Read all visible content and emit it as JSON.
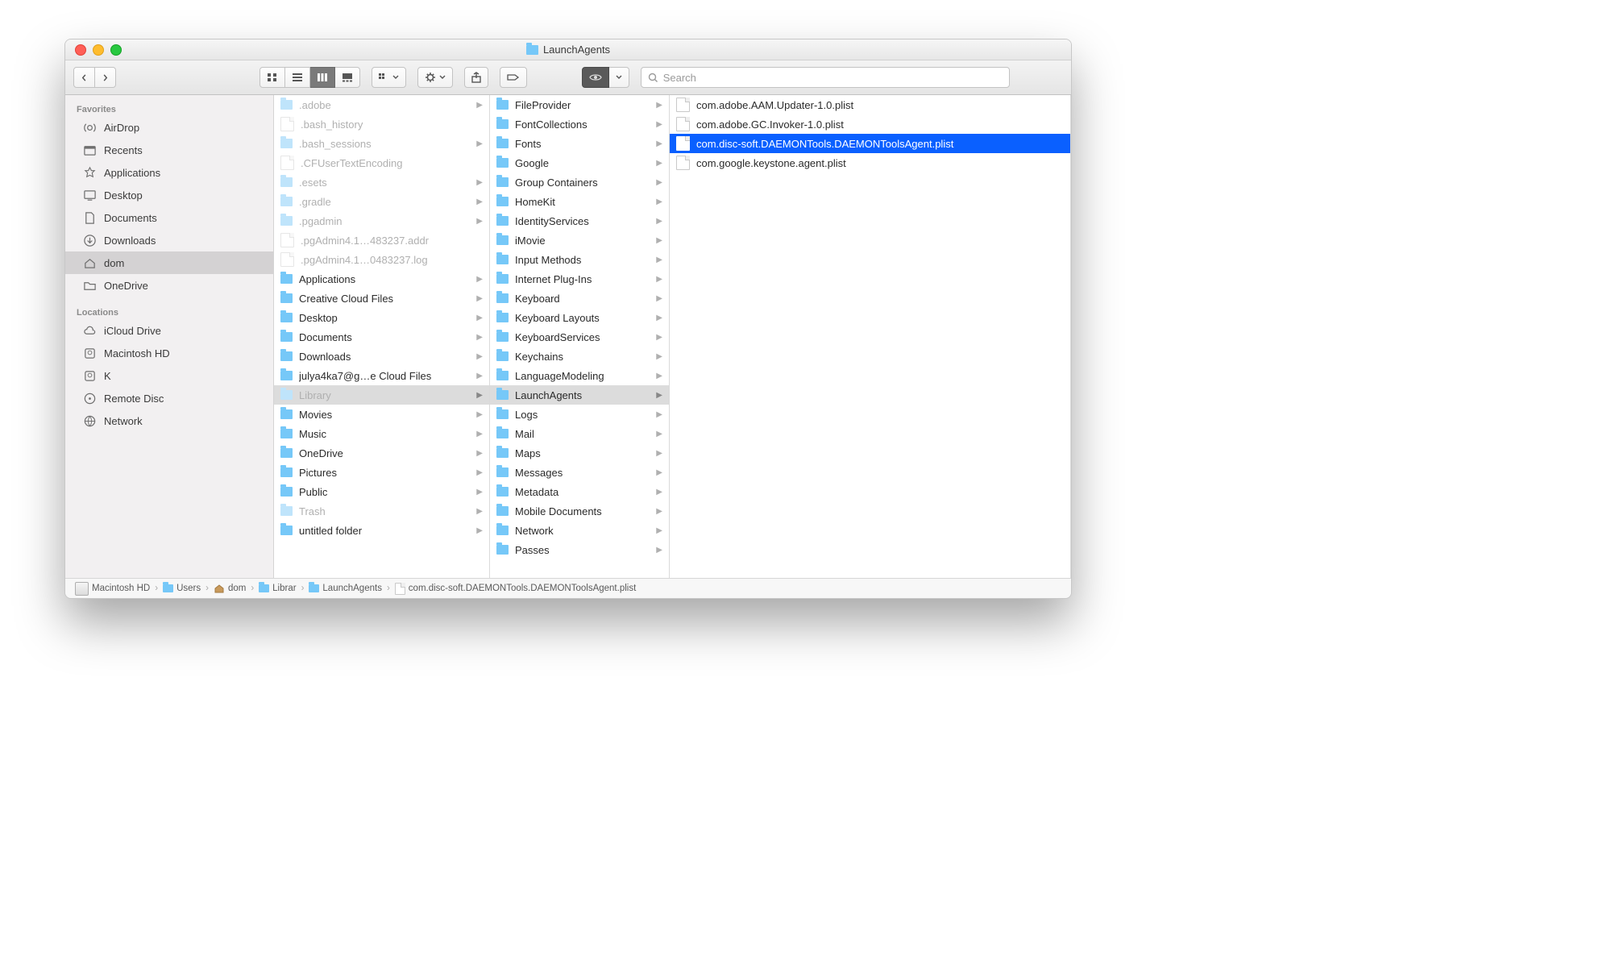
{
  "window_title": "LaunchAgents",
  "search_placeholder": "Search",
  "sidebar": {
    "favorites_label": "Favorites",
    "locations_label": "Locations",
    "favorites": [
      {
        "label": "AirDrop",
        "icon": "airdrop"
      },
      {
        "label": "Recents",
        "icon": "recents"
      },
      {
        "label": "Applications",
        "icon": "apps"
      },
      {
        "label": "Desktop",
        "icon": "desktop"
      },
      {
        "label": "Documents",
        "icon": "docs"
      },
      {
        "label": "Downloads",
        "icon": "downloads"
      },
      {
        "label": "dom",
        "icon": "home",
        "selected": true
      },
      {
        "label": "OneDrive",
        "icon": "folder"
      }
    ],
    "locations": [
      {
        "label": "iCloud Drive",
        "icon": "cloud"
      },
      {
        "label": "Macintosh HD",
        "icon": "hdd"
      },
      {
        "label": "K",
        "icon": "hdd"
      },
      {
        "label": "Remote Disc",
        "icon": "disc"
      },
      {
        "label": "Network",
        "icon": "network"
      }
    ]
  },
  "columns": {
    "col1": [
      {
        "label": ".adobe",
        "type": "folder-dim",
        "arrow": true
      },
      {
        "label": ".bash_history",
        "type": "file-dim"
      },
      {
        "label": ".bash_sessions",
        "type": "folder-dim",
        "arrow": true
      },
      {
        "label": ".CFUserTextEncoding",
        "type": "file-dim"
      },
      {
        "label": ".esets",
        "type": "folder-dim",
        "arrow": true
      },
      {
        "label": ".gradle",
        "type": "folder-dim",
        "arrow": true
      },
      {
        "label": ".pgadmin",
        "type": "folder-dim",
        "arrow": true
      },
      {
        "label": ".pgAdmin4.1…483237.addr",
        "type": "file-dim"
      },
      {
        "label": ".pgAdmin4.1…0483237.log",
        "type": "file-dim"
      },
      {
        "label": "Applications",
        "type": "folder",
        "arrow": true
      },
      {
        "label": "Creative Cloud Files",
        "type": "folder",
        "arrow": true
      },
      {
        "label": "Desktop",
        "type": "folder",
        "arrow": true
      },
      {
        "label": "Documents",
        "type": "folder",
        "arrow": true
      },
      {
        "label": "Downloads",
        "type": "folder",
        "arrow": true
      },
      {
        "label": "julya4ka7@g…e Cloud Files",
        "type": "folder",
        "arrow": true
      },
      {
        "label": "Library",
        "type": "folder-dim",
        "arrow": true,
        "path": true
      },
      {
        "label": "Movies",
        "type": "folder",
        "arrow": true
      },
      {
        "label": "Music",
        "type": "folder",
        "arrow": true
      },
      {
        "label": "OneDrive",
        "type": "folder",
        "arrow": true
      },
      {
        "label": "Pictures",
        "type": "folder",
        "arrow": true
      },
      {
        "label": "Public",
        "type": "folder",
        "arrow": true
      },
      {
        "label": "Trash",
        "type": "folder-dim",
        "arrow": true
      },
      {
        "label": "untitled folder",
        "type": "folder",
        "arrow": true
      }
    ],
    "col2": [
      {
        "label": "FileProvider",
        "type": "folder",
        "arrow": true
      },
      {
        "label": "FontCollections",
        "type": "folder",
        "arrow": true
      },
      {
        "label": "Fonts",
        "type": "folder",
        "arrow": true
      },
      {
        "label": "Google",
        "type": "folder",
        "arrow": true
      },
      {
        "label": "Group Containers",
        "type": "folder",
        "arrow": true
      },
      {
        "label": "HomeKit",
        "type": "folder",
        "arrow": true
      },
      {
        "label": "IdentityServices",
        "type": "folder",
        "arrow": true
      },
      {
        "label": "iMovie",
        "type": "folder",
        "arrow": true
      },
      {
        "label": "Input Methods",
        "type": "folder",
        "arrow": true
      },
      {
        "label": "Internet Plug-Ins",
        "type": "folder",
        "arrow": true
      },
      {
        "label": "Keyboard",
        "type": "folder",
        "arrow": true
      },
      {
        "label": "Keyboard Layouts",
        "type": "folder",
        "arrow": true
      },
      {
        "label": "KeyboardServices",
        "type": "folder",
        "arrow": true
      },
      {
        "label": "Keychains",
        "type": "folder",
        "arrow": true
      },
      {
        "label": "LanguageModeling",
        "type": "folder",
        "arrow": true
      },
      {
        "label": "LaunchAgents",
        "type": "folder",
        "arrow": true,
        "path": true
      },
      {
        "label": "Logs",
        "type": "folder",
        "arrow": true
      },
      {
        "label": "Mail",
        "type": "folder",
        "arrow": true
      },
      {
        "label": "Maps",
        "type": "folder",
        "arrow": true
      },
      {
        "label": "Messages",
        "type": "folder",
        "arrow": true
      },
      {
        "label": "Metadata",
        "type": "folder",
        "arrow": true
      },
      {
        "label": "Mobile Documents",
        "type": "folder",
        "arrow": true
      },
      {
        "label": "Network",
        "type": "folder",
        "arrow": true
      },
      {
        "label": "Passes",
        "type": "folder",
        "arrow": true
      }
    ],
    "col3": [
      {
        "label": "com.adobe.AAM.Updater-1.0.plist",
        "type": "file"
      },
      {
        "label": "com.adobe.GC.Invoker-1.0.plist",
        "type": "file"
      },
      {
        "label": "com.disc-soft.DAEMONTools.DAEMONToolsAgent.plist",
        "type": "file",
        "selected": true
      },
      {
        "label": "com.google.keystone.agent.plist",
        "type": "file"
      }
    ]
  },
  "pathbar": [
    {
      "label": "Macintosh HD",
      "icon": "hdd"
    },
    {
      "label": "Users",
      "icon": "folder"
    },
    {
      "label": "dom",
      "icon": "home"
    },
    {
      "label": "Librar",
      "icon": "folder"
    },
    {
      "label": "LaunchAgents",
      "icon": "folder"
    },
    {
      "label": "com.disc-soft.DAEMONTools.DAEMONToolsAgent.plist",
      "icon": "file"
    }
  ]
}
